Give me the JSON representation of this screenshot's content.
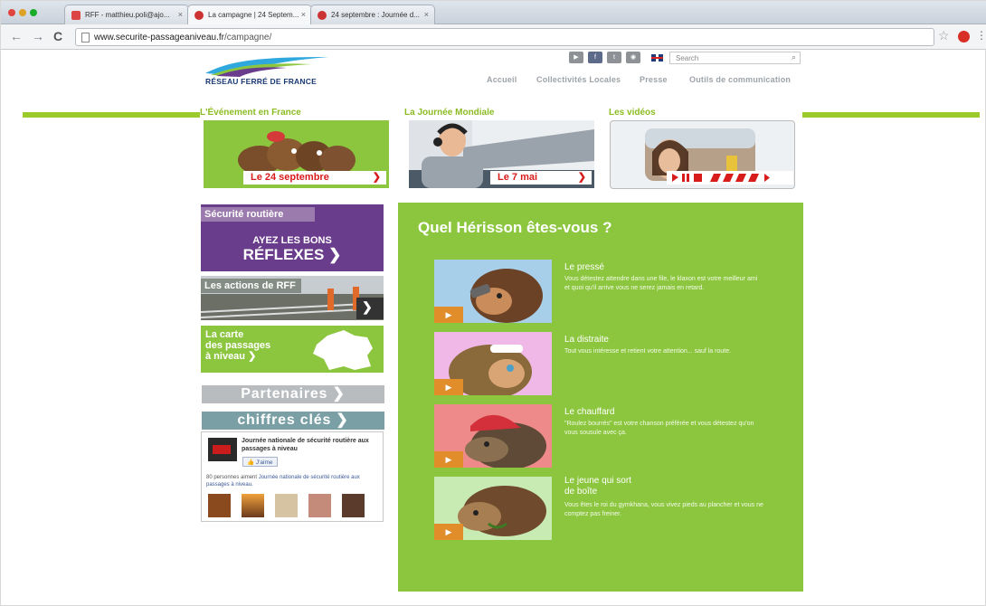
{
  "browser": {
    "tabs": [
      {
        "label": "RFF - matthieu.poli@ajo...",
        "color": "#cc3333"
      },
      {
        "label": "La campagne | 24 Septem...",
        "color": "#cc3333"
      },
      {
        "label": "24 septembre : Journée d...",
        "color": "#cc3333"
      }
    ],
    "url_domain": "www.securite-passageaniveau.fr",
    "url_path": "/campagne/"
  },
  "header": {
    "logo_text": "RÉSEAU FERRÉ DE FRANCE",
    "search_placeholder": "Search",
    "nav": [
      "Accueil",
      "Collectivités Locales",
      "Presse",
      "Outils de communication"
    ],
    "social_icons": [
      "youtube-icon",
      "facebook-icon",
      "twitter-icon",
      "rss-icon"
    ]
  },
  "sections": {
    "evenement": "L'Événement en France",
    "mondiale": "La Journée Mondiale",
    "videos": "Les vidéos"
  },
  "teasers": {
    "evenement_label": "Le 24 septembre",
    "mondiale_label": "Le 7 mai"
  },
  "left": {
    "securite_title": "Sécurité routière",
    "securite_line1": "AYEZ LES BONS",
    "securite_line2": "RÉFLEXES",
    "actions": "Les actions de RFF",
    "carte_line1": "La carte",
    "carte_line2": "des passages",
    "carte_line3": "à niveau",
    "partenaires": "Partenaires",
    "chiffres": "chiffres clés"
  },
  "facebook": {
    "page_title": "Journée nationale de sécurité routière aux passages à niveau",
    "like_label": "J'aime",
    "count_prefix": "80 personnes aiment",
    "count_link": "Journée nationale de sécurité routière aux passages à niveau."
  },
  "main": {
    "title": "Quel Hérisson êtes-vous ?",
    "cards": [
      {
        "title": "Le pressé",
        "text": "Vous détestez attendre dans une file, le klaxon est votre meilleur ami et quoi qu'il arrive vous ne serez jamais en retard."
      },
      {
        "title": "La distraite",
        "text": "Tout vous intéresse et retient votre attention... sauf la route."
      },
      {
        "title": "Le chauffard",
        "text": "\"Roulez bourrés\" est votre chanson préférée et vous détestez qu'on vous sousule avec ça."
      },
      {
        "title": "Le jeune qui sort",
        "title2": "de boîte",
        "text": "Vous êtes le roi du gymkhana, vous vivez pieds au plancher et vous ne comptez pas freiner."
      }
    ]
  },
  "colors": {
    "brand_green": "#8cc63f",
    "accent_red": "#d81b1b",
    "purple": "#6a3c8c"
  }
}
